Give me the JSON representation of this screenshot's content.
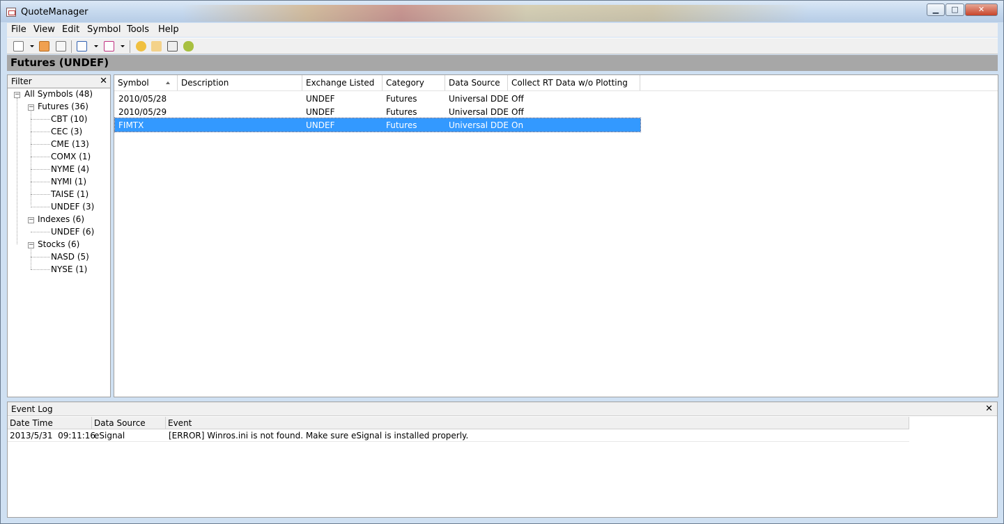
{
  "window": {
    "title": "QuoteManager"
  },
  "menu": [
    "File",
    "View",
    "Edit",
    "Symbol",
    "Tools",
    "Help"
  ],
  "toolbar": {
    "buttons": [
      "new-symbol-icon",
      "import-icon",
      "delete-icon",
      "export-icon",
      "download-icon",
      "settings-gear-icon",
      "chart-icon",
      "calendar-icon",
      "android-icon"
    ]
  },
  "header": {
    "title": "Futures (UNDEF)"
  },
  "filter": {
    "title": "Filter",
    "close": "✕",
    "tree": [
      {
        "label": "All Symbols (48)"
      },
      {
        "label": "Futures (36)"
      },
      {
        "label": "CBT (10)"
      },
      {
        "label": "CEC (3)"
      },
      {
        "label": "CME (13)"
      },
      {
        "label": "COMX (1)"
      },
      {
        "label": "NYME (4)"
      },
      {
        "label": "NYMI (1)"
      },
      {
        "label": "TAISE (1)"
      },
      {
        "label": "UNDEF (3)"
      },
      {
        "label": "Indexes (6)"
      },
      {
        "label": "UNDEF (6)"
      },
      {
        "label": "Stocks (6)"
      },
      {
        "label": "NASD (5)"
      },
      {
        "label": "NYSE (1)"
      }
    ]
  },
  "grid": {
    "columns": [
      "Symbol",
      "Description",
      "Exchange Listed",
      "Category",
      "Data Source",
      "Collect RT Data w/o Plotting"
    ],
    "rows": [
      {
        "symbol": "2010/05/28",
        "description": "",
        "exchange": "UNDEF",
        "category": "Futures",
        "source": "Universal DDE",
        "collect": "Off"
      },
      {
        "symbol": "2010/05/29",
        "description": "",
        "exchange": "UNDEF",
        "category": "Futures",
        "source": "Universal DDE",
        "collect": "Off"
      },
      {
        "symbol": "FIMTX",
        "description": "",
        "exchange": "UNDEF",
        "category": "Futures",
        "source": "Universal DDE",
        "collect": "On"
      }
    ]
  },
  "event_log": {
    "title": "Event Log",
    "close": "✕",
    "columns": [
      "Date Time",
      "Data Source",
      "Event"
    ],
    "rows": [
      {
        "datetime": "2013/5/31  09:11:16",
        "source": "eSignal",
        "event": "[ERROR] Winros.ini is not found. Make sure eSignal is installed properly."
      }
    ]
  }
}
